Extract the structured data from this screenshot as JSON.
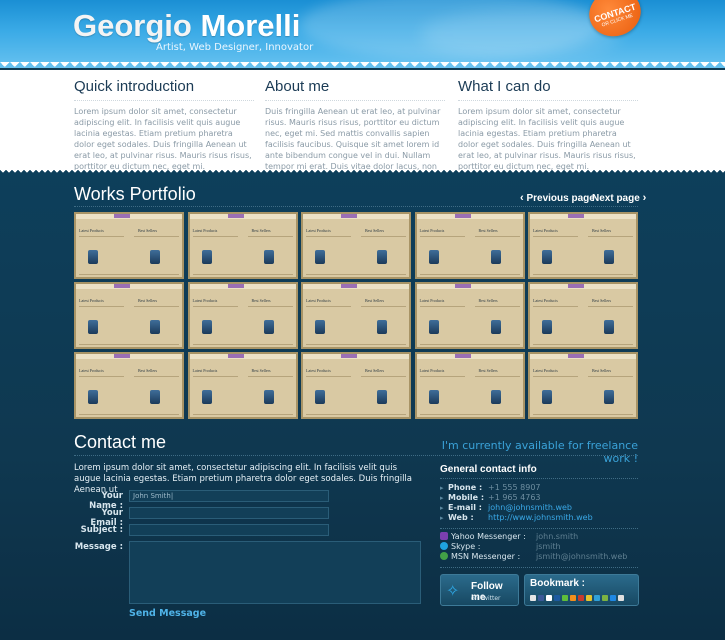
{
  "header": {
    "name_first": "Georgio",
    "name_last": "Morelli",
    "tagline": "Artist, Web Designer, Innovator",
    "contact_badge": "CONTACT",
    "contact_badge_sub": "OR CLICK ME"
  },
  "intro": [
    {
      "title": "Quick introduction",
      "text": "Lorem ipsum dolor sit amet, consectetur adipiscing elit. In facilisis velit quis augue lacinia egestas. Etiam pretium pharetra dolor eget sodales. Duis fringilla Aenean ut erat leo, at pulvinar risus. Mauris risus risus, porttitor eu dictum nec, eget mi."
    },
    {
      "title": "About me",
      "text": "Duis fringilla Aenean ut erat leo, at pulvinar risus. Mauris risus risus, porttitor eu dictum nec, eget mi. Sed mattis convallis sapien facilisis faucibus. Quisque sit amet lorem id ante bibendum congue vel in dui. Nullam tempor mi erat. Duis vitae dolor lacus, non"
    },
    {
      "title": "What I can do",
      "text": "Lorem ipsum dolor sit amet, consectetur adipiscing elit. In facilisis velit quis augue lacinia egestas. Etiam pretium pharetra dolor eget sodales. Duis fringilla Aenean ut erat leo, at pulvinar risus. Mauris risus risus, porttitor eu dictum nec, eget mi."
    }
  ],
  "portfolio": {
    "title": "Works Portfolio",
    "prev": "Previous page",
    "next": "Next page",
    "thumb_left": "Latest Products",
    "thumb_right": "Best Sellers",
    "rows": 3,
    "cols": 5
  },
  "contact": {
    "title": "Contact me",
    "freelance": "I'm currently available for freelance work !",
    "text": "Lorem ipsum dolor sit amet, consectetur adipiscing elit. In facilisis velit quis augue lacinia egestas. Etiam pretium pharetra dolor eget sodales. Duis fringilla Aenean ut",
    "name_label": "Your Name :",
    "name_value": "John Smith|",
    "email_label": "Your Email :",
    "subject_label": "Subject :",
    "message_label": "Message :",
    "send": "Send Message"
  },
  "info": {
    "title": "General contact info",
    "phone_label": "Phone :",
    "phone": "+1 555 8907",
    "mobile_label": "Mobile :",
    "mobile": "+1 965 4763",
    "email_label": "E-mail :",
    "email": "john@johnsmith.web",
    "web_label": "Web :",
    "web": "http://www.johnsmith.web",
    "yahoo_label": "Yahoo Messenger :",
    "yahoo": "john.smith",
    "skype_label": "Skype :",
    "skype": "jsmith",
    "msn_label": "MSN Messenger :",
    "msn": "jsmith@johnsmith.web"
  },
  "social": {
    "follow": "Follow me",
    "on_twitter": "on Twitter",
    "bookmark": "Bookmark :"
  },
  "colors": {
    "accent": "#3aa8e6",
    "badge": "#e85b0c",
    "background": "#0e3a52"
  }
}
